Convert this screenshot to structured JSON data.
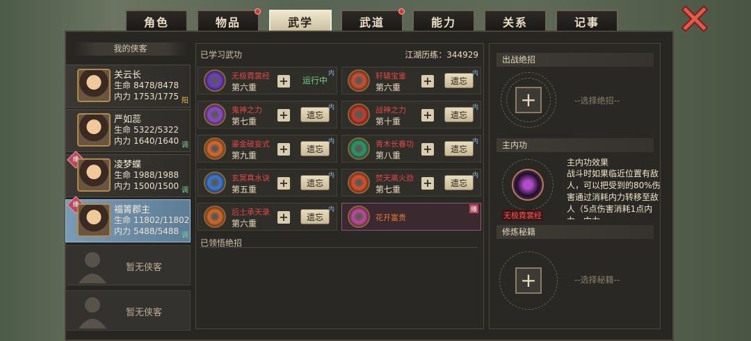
{
  "tabs": [
    {
      "label": "角色",
      "badge": false,
      "active": false
    },
    {
      "label": "物品",
      "badge": true,
      "active": false
    },
    {
      "label": "武学",
      "badge": false,
      "active": true
    },
    {
      "label": "武道",
      "badge": true,
      "active": false
    },
    {
      "label": "能力",
      "badge": false,
      "active": false
    },
    {
      "label": "关系",
      "badge": false,
      "active": false
    },
    {
      "label": "记事",
      "badge": false,
      "active": false
    }
  ],
  "left": {
    "title": "我的侠客",
    "heroes": [
      {
        "name": "关云长",
        "hp_label": "生命",
        "hp": "8478/8478",
        "mp_label": "内力",
        "mp": "1753/1775",
        "tag": "阳",
        "yuan": "",
        "selected": false
      },
      {
        "name": "严如蕊",
        "hp_label": "生命",
        "hp": "5322/5322",
        "mp_label": "内力",
        "mp": "1640/1640",
        "tag": "调",
        "yuan": "",
        "selected": false
      },
      {
        "name": "凌梦蝶",
        "hp_label": "生命",
        "hp": "1988/1988",
        "mp_label": "内力",
        "mp": "1500/1500",
        "tag": "调",
        "yuan": "缘",
        "selected": false
      },
      {
        "name": "福箐郡主",
        "hp_label": "生命",
        "hp": "11802/11802",
        "mp_label": "内力",
        "mp": "5488/5488",
        "tag": "调",
        "yuan": "缘",
        "selected": true
      }
    ],
    "empty_label_1": "暂无侠客",
    "empty_label_2": "暂无侠客"
  },
  "middle": {
    "learned_label": "已学习武功",
    "exp_text": "江湖历练：344929",
    "skills": [
      {
        "name": "无极霓裳经",
        "level": "第六重",
        "status": "运行中",
        "nei": "内",
        "icon_color": "#6a3cc8"
      },
      {
        "name": "轩辕宝鉴",
        "level": "第六重",
        "status": "遗忘",
        "nei": "内",
        "icon_color": "#d05030"
      },
      {
        "name": "鬼神之力",
        "level": "第七重",
        "status": "遗忘",
        "nei": "内",
        "icon_color": "#8a4cd0"
      },
      {
        "name": "战神之力",
        "level": "第十重",
        "status": "遗忘",
        "nei": "内",
        "icon_color": "#c83c2c"
      },
      {
        "name": "鎏金破妄式",
        "level": "第九重",
        "status": "遗忘",
        "nei": "内",
        "icon_color": "#e06a2a"
      },
      {
        "name": "青木长春功",
        "level": "第八重",
        "status": "遗忘",
        "nei": "内",
        "icon_color": "#2a9a6a"
      },
      {
        "name": "玄冥真水诀",
        "level": "第五重",
        "status": "遗忘",
        "nei": "内",
        "icon_color": "#3a7ad8"
      },
      {
        "name": "焚天离火劲",
        "level": "第七重",
        "status": "遗忘",
        "nei": "内",
        "icon_color": "#e0502a"
      },
      {
        "name": "后土承天录",
        "level": "第六重",
        "status": "遗忘",
        "nei": "内",
        "icon_color": "#d86a2a"
      },
      {
        "name": "花开富贵",
        "level": "",
        "status": "",
        "nei": "缘",
        "icon_color": "#c04c9a"
      }
    ],
    "plus_glyph": "+",
    "understood_label": "已领悟绝招"
  },
  "right": {
    "ultimate_label": "出战绝招",
    "ultimate_slot_text": "--选择绝招--",
    "inner_label": "主内功",
    "inner_effect_title": "主内功效果",
    "inner_effect_text": "战斗时如果临近位置有敌人，可以把受到的80%伤害通过消耗内力转移至敌人（5点伤害消耗1点内力，内力",
    "inner_name": "无极霓裳经",
    "manual_label": "修炼秘籍",
    "manual_slot_text": "--选择秘籍--",
    "plus_glyph": "+"
  },
  "colors": {
    "accent_red": "#e04848",
    "running_green": "#6fd48a",
    "selected_blue": "#7a9bb5"
  }
}
